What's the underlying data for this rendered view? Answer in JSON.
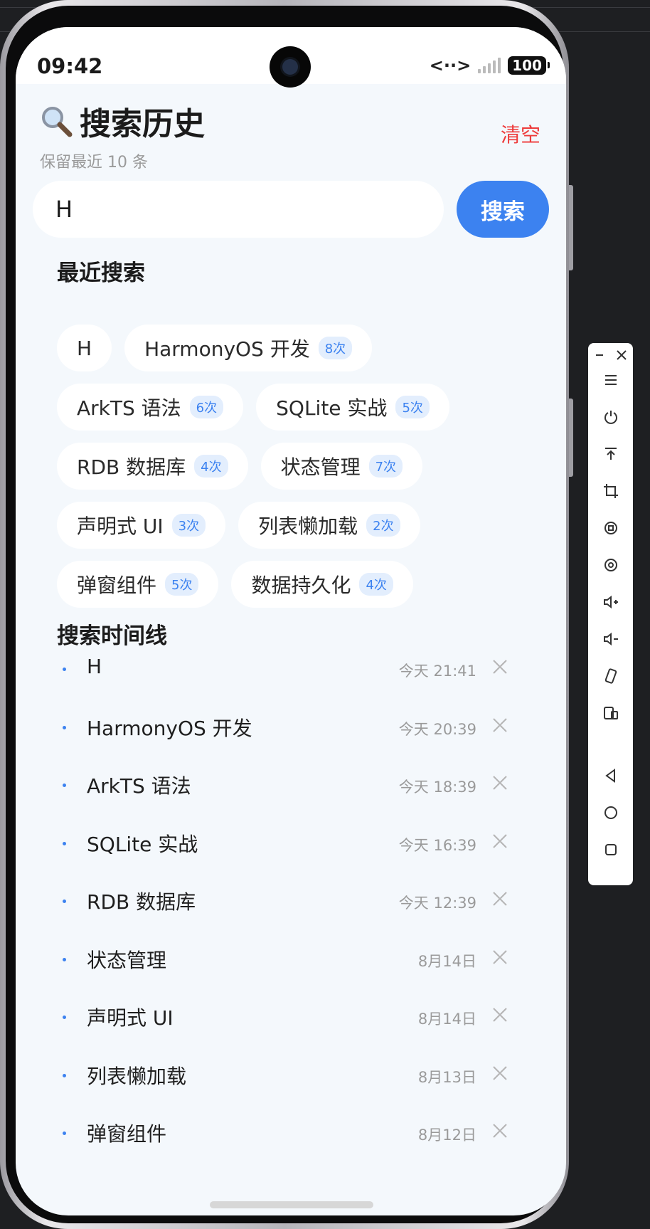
{
  "status_bar": {
    "time": "09:42",
    "network_symbol": "<··>",
    "battery": "100"
  },
  "header": {
    "icon": "search-icon",
    "title": "搜索历史",
    "subtitle": "保留最近 10 条",
    "clear_label": "清空"
  },
  "search": {
    "value": "H",
    "button_label": "搜索"
  },
  "recent": {
    "title": "最近搜索",
    "rows": [
      [
        {
          "label": "H",
          "count": ""
        },
        {
          "label": "HarmonyOS 开发",
          "count": "8次"
        }
      ],
      [
        {
          "label": "ArkTS 语法",
          "count": "6次"
        },
        {
          "label": "SQLite 实战",
          "count": "5次"
        }
      ],
      [
        {
          "label": "RDB 数据库",
          "count": "4次"
        },
        {
          "label": "状态管理",
          "count": "7次"
        }
      ],
      [
        {
          "label": "声明式 UI",
          "count": "3次"
        },
        {
          "label": "列表懒加载",
          "count": "2次"
        }
      ],
      [
        {
          "label": "弹窗组件",
          "count": "5次"
        },
        {
          "label": "数据持久化",
          "count": "4次"
        }
      ]
    ]
  },
  "timeline": {
    "title": "搜索时间线",
    "items": [
      {
        "name": "H",
        "time": "今天 21:41"
      },
      {
        "name": "HarmonyOS 开发",
        "time": "今天 20:39"
      },
      {
        "name": "ArkTS 语法",
        "time": "今天 18:39"
      },
      {
        "name": "SQLite 实战",
        "time": "今天 16:39"
      },
      {
        "name": "RDB 数据库",
        "time": "今天 12:39"
      },
      {
        "name": "状态管理",
        "time": "8月14日"
      },
      {
        "name": "声明式 UI",
        "time": "8月14日"
      },
      {
        "name": "列表懒加载",
        "time": "8月13日"
      },
      {
        "name": "弹窗组件",
        "time": "8月12日"
      }
    ]
  },
  "colors": {
    "accent": "#3c82f0",
    "danger": "#ee3b3b",
    "background": "#f4f8fc"
  },
  "emulator_toolbar": {
    "icons": [
      "minimize-icon",
      "close-icon",
      "menu-icon",
      "power-icon",
      "pin-top-icon",
      "crop-icon",
      "rotate-left-icon",
      "rotate-right-icon",
      "volume-up-icon",
      "volume-down-icon",
      "shake-icon",
      "fold-icon",
      "back-icon",
      "home-icon",
      "recents-icon"
    ]
  }
}
